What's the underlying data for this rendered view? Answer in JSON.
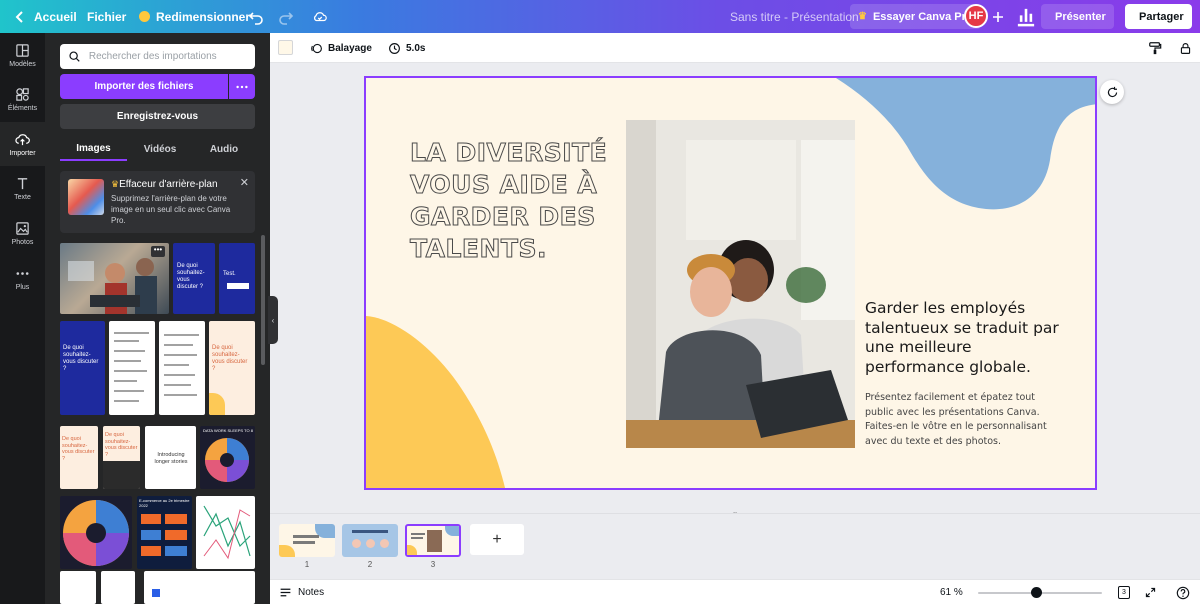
{
  "topbar": {
    "home_label": "Accueil",
    "file_label": "Fichier",
    "resize_label": "Redimensionner",
    "doc_title": "Sans titre - Présentation",
    "try_pro_label": "Essayer Canva Pro",
    "avatar_initials": "HF",
    "present_label": "Présenter",
    "share_label": "Partager"
  },
  "rail": {
    "items": [
      {
        "label": "Modèles",
        "icon": "layout-icon"
      },
      {
        "label": "Éléments",
        "icon": "shapes-icon"
      },
      {
        "label": "Importer",
        "icon": "upload-cloud-icon"
      },
      {
        "label": "Texte",
        "icon": "text-icon"
      },
      {
        "label": "Photos",
        "icon": "image-icon"
      },
      {
        "label": "Plus",
        "icon": "more-icon"
      }
    ],
    "active": "Importer"
  },
  "panel": {
    "search_placeholder": "Rechercher des importations",
    "import_button": "Importer des fichiers",
    "register_button": "Enregistrez-vous",
    "tabs": [
      "Images",
      "Vidéos",
      "Audio"
    ],
    "active_tab": "Images",
    "promo": {
      "title": "Effaceur d'arrière-plan",
      "description": "Supprimez l'arrière-plan de votre image en un seul clic avec Canva Pro."
    },
    "thumbnails": [
      {
        "kind": "photo"
      },
      {
        "kind": "slide",
        "text": "De quoi souhaitez-vous discuter ?"
      },
      {
        "kind": "slide",
        "text": "Test."
      },
      {
        "kind": "slide",
        "text": "De quoi souhaitez-vous discuter ?"
      },
      {
        "kind": "doc"
      },
      {
        "kind": "doc"
      },
      {
        "kind": "slide",
        "text": "De quoi souhaitez-vous discuter ?"
      },
      {
        "kind": "slide",
        "text": "De quoi souhaitez-vous discuter ?"
      },
      {
        "kind": "slide",
        "text": "De quoi souhaitez-vous discuter ?"
      },
      {
        "kind": "slide",
        "text": "Introducing longer stories"
      },
      {
        "kind": "chart",
        "text": "DATA WORK SLEEPS TO 8"
      },
      {
        "kind": "chart"
      },
      {
        "kind": "slide",
        "text": "E-commerce au 2e trimestre 2022"
      },
      {
        "kind": "chart"
      },
      {
        "kind": "doc"
      },
      {
        "kind": "doc"
      },
      {
        "kind": "doc"
      }
    ]
  },
  "editor_toolbar": {
    "animation_label": "Balayage",
    "duration_label": "5.0s",
    "bg_color": "#fff8e8"
  },
  "slide": {
    "title": "LA DIVERSITÉ VOUS AIDE À GARDER DES TALENTS.",
    "heading": "Garder les employés talentueux se traduit par une meilleure performance globale.",
    "body": "Présentez facilement et épatez tout public avec les présentations Canva. Faites-en le vôtre en le personnalisant avec du texte et des photos.",
    "colors": {
      "background": "#fef6e7",
      "blue_blob": "#85b1db",
      "yellow_blob": "#fdc956",
      "selection": "#8b3dff"
    }
  },
  "pages": {
    "items": [
      {
        "number": "1"
      },
      {
        "number": "2"
      },
      {
        "number": "3"
      }
    ],
    "active": "3"
  },
  "bottombar": {
    "notes_label": "Notes",
    "zoom_label": "61 %",
    "page_count": "3"
  }
}
